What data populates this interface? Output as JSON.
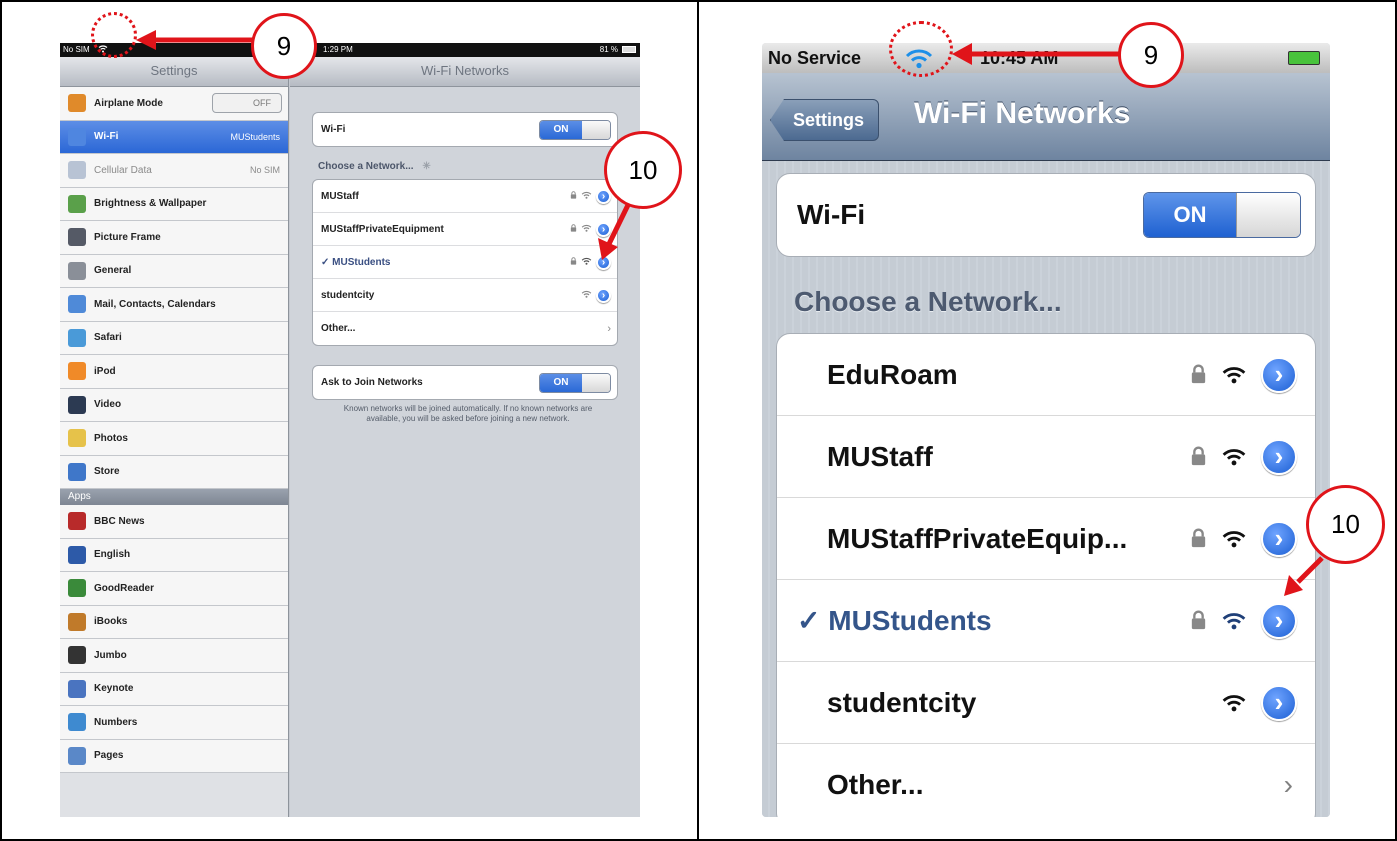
{
  "ipad": {
    "status": {
      "carrier": "No SIM",
      "time": "1:29 PM",
      "battery": "81 %"
    },
    "sidebar_title": "Settings",
    "main_title": "Wi-Fi Networks",
    "settings": [
      {
        "label": "Airplane Mode",
        "value": "OFF",
        "icon_color": "#e08a2a",
        "icon": "airplane-icon"
      },
      {
        "label": "Wi-Fi",
        "value": "MUStudents",
        "icon_color": "#4f86e0",
        "icon": "wifi-icon"
      },
      {
        "label": "Cellular Data",
        "value": "No SIM",
        "icon_color": "#b8c3d4",
        "icon": "cellular-icon"
      },
      {
        "label": "Brightness & Wallpaper",
        "value": "",
        "icon_color": "#5aa04a",
        "icon": "brightness-icon"
      },
      {
        "label": "Picture Frame",
        "value": "",
        "icon_color": "#555a66",
        "icon": "picture-frame-icon"
      },
      {
        "label": "General",
        "value": "",
        "icon_color": "#8a8f98",
        "icon": "gear-icon"
      },
      {
        "label": "Mail, Contacts, Calendars",
        "value": "",
        "icon_color": "#4f8ad8",
        "icon": "mail-icon"
      },
      {
        "label": "Safari",
        "value": "",
        "icon_color": "#4a9ad8",
        "icon": "safari-icon"
      },
      {
        "label": "iPod",
        "value": "",
        "icon_color": "#f08a28",
        "icon": "ipod-icon"
      },
      {
        "label": "Video",
        "value": "",
        "icon_color": "#2c3a52",
        "icon": "video-icon"
      },
      {
        "label": "Photos",
        "value": "",
        "icon_color": "#e6c24a",
        "icon": "photos-icon"
      },
      {
        "label": "Store",
        "value": "",
        "icon_color": "#3f77c9",
        "icon": "store-icon"
      }
    ],
    "apps_header": "Apps",
    "apps": [
      {
        "label": "BBC News",
        "icon_color": "#b82a2a",
        "icon": "bbc-news-icon"
      },
      {
        "label": "English",
        "icon_color": "#2d5aa8",
        "icon": "english-icon"
      },
      {
        "label": "GoodReader",
        "icon_color": "#3a8a3a",
        "icon": "goodreader-icon"
      },
      {
        "label": "iBooks",
        "icon_color": "#c07a2a",
        "icon": "ibooks-icon"
      },
      {
        "label": "Jumbo",
        "icon_color": "#333333",
        "icon": "jumbo-icon"
      },
      {
        "label": "Keynote",
        "icon_color": "#4a74c0",
        "icon": "keynote-icon"
      },
      {
        "label": "Numbers",
        "icon_color": "#3e8ad0",
        "icon": "numbers-icon"
      },
      {
        "label": "Pages",
        "icon_color": "#5a88c8",
        "icon": "pages-icon"
      }
    ],
    "wifi_label": "Wi-Fi",
    "wifi_toggle": "ON",
    "choose_label": "Choose a Network...",
    "networks": [
      {
        "name": "MUStaff",
        "locked": true,
        "selected": false
      },
      {
        "name": "MUStaffPrivateEquipment",
        "locked": true,
        "selected": false
      },
      {
        "name": "MUStudents",
        "locked": true,
        "selected": true
      },
      {
        "name": "studentcity",
        "locked": false,
        "selected": false
      }
    ],
    "other_label": "Other...",
    "ask_label": "Ask to Join Networks",
    "ask_toggle": "ON",
    "footnote": "Known networks will be joined automatically.  If no known networks are available, you will be asked before joining a new network."
  },
  "iphone": {
    "status": {
      "carrier": "No Service",
      "time": "10:45 AM"
    },
    "back_label": "Settings",
    "title": "Wi-Fi Networks",
    "wifi_label": "Wi-Fi",
    "wifi_toggle": "ON",
    "choose_label": "Choose a Network...",
    "networks": [
      {
        "name": "EduRoam",
        "locked": true,
        "selected": false
      },
      {
        "name": "MUStaff",
        "locked": true,
        "selected": false
      },
      {
        "name": "MUStaffPrivateEquip...",
        "locked": true,
        "selected": false
      },
      {
        "name": "MUStudents",
        "locked": true,
        "selected": true
      },
      {
        "name": "studentcity",
        "locked": false,
        "selected": false
      }
    ],
    "other_label": "Other..."
  },
  "annotations": {
    "callout_status": "9",
    "callout_detail": "10",
    "accent_color": "#e0141a"
  },
  "symbols": {
    "check": "✓",
    "chevron": "›",
    "detail": "›"
  }
}
